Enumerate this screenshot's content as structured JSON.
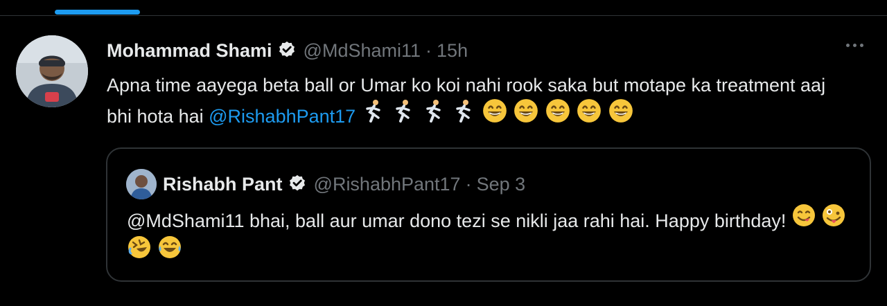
{
  "tweet": {
    "author_name": "Mohammad Shami",
    "handle": "@MdShami11",
    "separator": "·",
    "time": "15h",
    "text_main": "Apna time aayega beta ball or Umar ko koi nahi rook saka but motape ka treatment aaj bhi hota hai ",
    "mention": "@RishabhPant17",
    "emojis": [
      "runner-emoji",
      "runner-emoji",
      "runner-emoji",
      "runner-emoji",
      "grinning-emoji",
      "grinning-emoji",
      "grinning-emoji",
      "grinning-emoji",
      "grinning-emoji"
    ]
  },
  "quote": {
    "author_name": "Rishabh Pant",
    "handle": "@RishabhPant17",
    "separator": "·",
    "time": "Sep 3",
    "mention": "@MdShami11",
    "text_main": " bhai, ball aur umar dono tezi se nikli jaa rahi hai. Happy birthday! ",
    "emojis": [
      "yum-emoji",
      "zany-emoji",
      "rofl-emoji",
      "joy-emoji"
    ]
  },
  "colors": {
    "background": "#000000",
    "text": "#e7e9ea",
    "muted": "#71767b",
    "link": "#1d9bf0",
    "border": "#2f3336",
    "emoji": "#f7c63b"
  }
}
